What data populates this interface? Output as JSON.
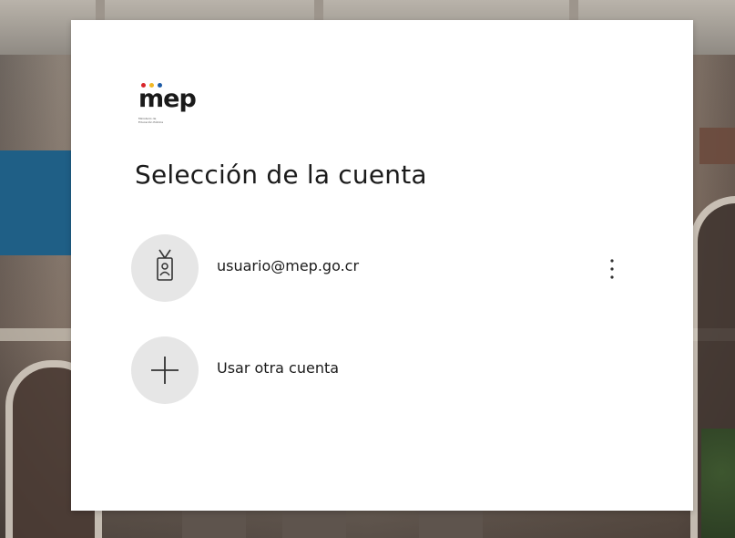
{
  "logo": {
    "brand": "mep",
    "line1": "Ministerio de",
    "line2": "Educación Pública",
    "colors": {
      "text": "#1a1a1a",
      "dot_red": "#d9252a",
      "dot_yellow": "#f2b824",
      "dot_blue": "#1c5aa6"
    }
  },
  "dialog": {
    "title": "Selección de la cuenta"
  },
  "accounts": [
    {
      "label": "usuario@mep.go.cr",
      "icon": "badge-icon"
    }
  ],
  "add_account": {
    "label": "Usar otra cuenta",
    "icon": "plus-icon"
  },
  "more_options": {
    "icon": "more-vertical-icon"
  }
}
